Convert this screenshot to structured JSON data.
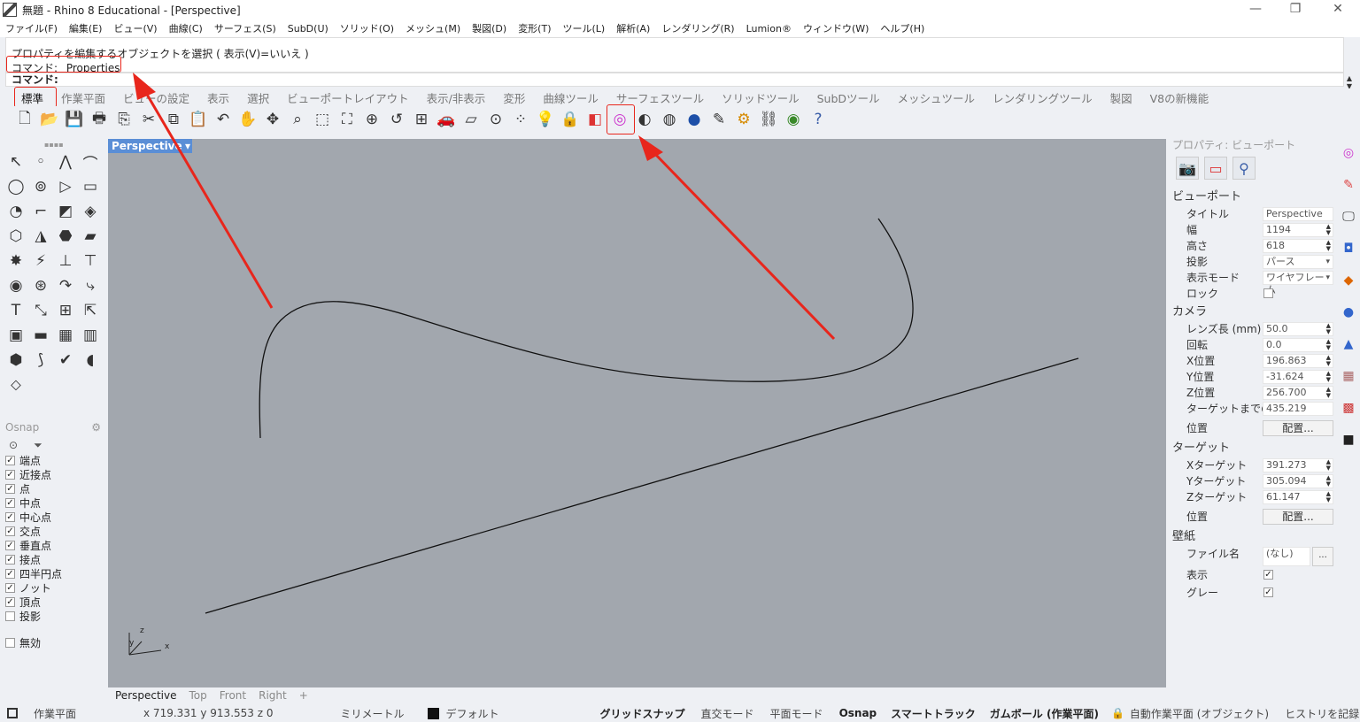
{
  "window": {
    "title": "無題 - Rhino 8 Educational - [Perspective]",
    "minimize": "—",
    "restore": "❐",
    "close": "✕"
  },
  "menu": [
    "ファイル(F)",
    "編集(E)",
    "ビュー(V)",
    "曲線(C)",
    "サーフェス(S)",
    "SubD(U)",
    "ソリッド(O)",
    "メッシュ(M)",
    "製図(D)",
    "変形(T)",
    "ツール(L)",
    "解析(A)",
    "レンダリング(R)",
    "Lumion®",
    "ウィンドウ(W)",
    "ヘルプ(H)"
  ],
  "history": {
    "line1": "プロパティを編集するオブジェクトを選択 ( 表示(V)=いいえ )",
    "line2": "コマンド: _Properties"
  },
  "command_prompt": "コマンド:",
  "tabs": [
    "標準",
    "作業平面",
    "ビューの設定",
    "表示",
    "選択",
    "ビューポートレイアウト",
    "表示/非表示",
    "変形",
    "曲線ツール",
    "サーフェスツール",
    "ソリッドツール",
    "SubDツール",
    "メッシュツール",
    "レンダリングツール",
    "製図",
    "V8の新機能"
  ],
  "toolbar_icons": [
    "new-file-icon",
    "open-icon",
    "save-icon",
    "print-icon",
    "import-icon",
    "cut-icon",
    "copy-icon",
    "paste-icon",
    "undo-icon",
    "pan-hand-icon",
    "rotate-view-icon",
    "zoom-icon",
    "zoom-window-icon",
    "zoom-extents-icon",
    "zoom-selected-icon",
    "undo-view-icon",
    "four-viewports-icon",
    "car-icon",
    "cplane-icon",
    "point-icon",
    "select-icon",
    "light-icon",
    "lock-icon",
    "layer-icon",
    "properties-color-wheel-icon",
    "sphere-shaded-icon",
    "rendered-sphere-icon",
    "render-icon",
    "tools-icon",
    "gear-icon",
    "snapshot-icon",
    "globe-icon",
    "help-icon"
  ],
  "viewport": {
    "label": "Perspective",
    "dropdown": "▾"
  },
  "viewport_tabs": [
    "Perspective",
    "Top",
    "Front",
    "Right",
    "+"
  ],
  "osnap": {
    "title": "Osnap",
    "items": [
      {
        "label": "端点",
        "checked": true
      },
      {
        "label": "近接点",
        "checked": true
      },
      {
        "label": "点",
        "checked": true
      },
      {
        "label": "中点",
        "checked": true
      },
      {
        "label": "中心点",
        "checked": true
      },
      {
        "label": "交点",
        "checked": true
      },
      {
        "label": "垂直点",
        "checked": true
      },
      {
        "label": "接点",
        "checked": true
      },
      {
        "label": "四半円点",
        "checked": true
      },
      {
        "label": "ノット",
        "checked": true
      },
      {
        "label": "頂点",
        "checked": true
      },
      {
        "label": "投影",
        "checked": false
      }
    ],
    "disable": {
      "label": "無効",
      "checked": false
    }
  },
  "properties": {
    "header": "プロパティ: ビューポート",
    "viewport_section": "ビューポート",
    "rows1": [
      {
        "label": "タイトル",
        "value": "Perspective",
        "kind": "text"
      },
      {
        "label": "幅",
        "value": "1194",
        "kind": "spin"
      },
      {
        "label": "高さ",
        "value": "618",
        "kind": "spin"
      },
      {
        "label": "投影",
        "value": "パース",
        "kind": "drop"
      },
      {
        "label": "表示モード",
        "value": "ワイヤフレーム",
        "kind": "drop"
      },
      {
        "label": "ロック",
        "value": "",
        "kind": "check"
      }
    ],
    "camera_section": "カメラ",
    "rows2": [
      {
        "label": "レンズ長 (mm)",
        "value": "50.0",
        "kind": "spin"
      },
      {
        "label": "回転",
        "value": "0.0",
        "kind": "spin"
      },
      {
        "label": "X位置",
        "value": "196.863",
        "kind": "spin"
      },
      {
        "label": "Y位置",
        "value": "-31.624",
        "kind": "spin"
      },
      {
        "label": "Z位置",
        "value": "256.700",
        "kind": "spin"
      },
      {
        "label": "ターゲットまでの",
        "value": "435.219",
        "kind": "text"
      },
      {
        "label": "位置",
        "value": "配置...",
        "kind": "button"
      }
    ],
    "target_section": "ターゲット",
    "rows3": [
      {
        "label": "Xターゲット",
        "value": "391.273",
        "kind": "spin"
      },
      {
        "label": "Yターゲット",
        "value": "305.094",
        "kind": "spin"
      },
      {
        "label": "Zターゲット",
        "value": "61.147",
        "kind": "spin"
      },
      {
        "label": "位置",
        "value": "配置...",
        "kind": "button"
      }
    ],
    "wallpaper_section": "壁紙",
    "rows4": [
      {
        "label": "ファイル名",
        "value": "(なし)",
        "kind": "file"
      },
      {
        "label": "表示",
        "value": "",
        "kind": "checked"
      },
      {
        "label": "グレー",
        "value": "",
        "kind": "checked"
      }
    ]
  },
  "status": {
    "cplane": "作業平面",
    "coords": "x 719.331  y 913.553  z 0",
    "units": "ミリメートル",
    "layer": "デフォルト",
    "grid_snap": "グリッドスナップ",
    "ortho": "直交モード",
    "planar": "平面モード",
    "osnap": "Osnap",
    "smart_track": "スマートトラック",
    "gumball": "ガムボール (作業平面)",
    "auto_cplane": "自動作業平面 (オブジェクト)",
    "history": "ヒストリを記録"
  },
  "colors": {
    "accent": "#5a8ed6",
    "annotation": "#e8261c",
    "viewport_bg": "#a2a7ae"
  }
}
